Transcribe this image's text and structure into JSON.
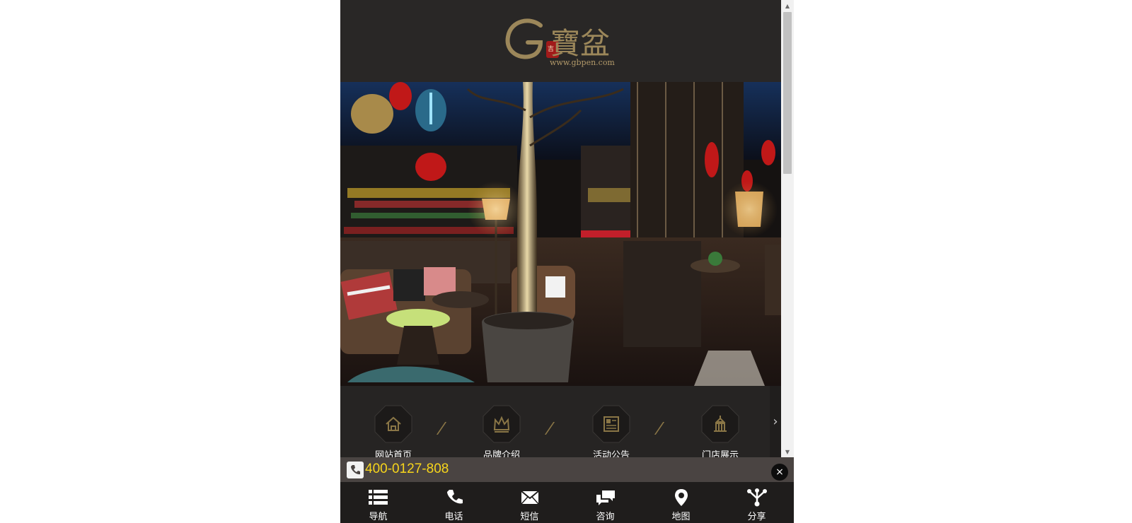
{
  "logo": {
    "brand_glyph": "G",
    "brand_text": "寶盆",
    "url": "www.gbpen.com"
  },
  "nav": {
    "items": [
      {
        "label": "网站首页",
        "icon": "home-icon"
      },
      {
        "label": "品牌介绍",
        "icon": "crown-icon"
      },
      {
        "label": "活动公告",
        "icon": "newspaper-icon"
      },
      {
        "label": "门店展示",
        "icon": "building-icon"
      }
    ],
    "separator": "/",
    "next": "›"
  },
  "phone_bar": {
    "number": "400-0127-808",
    "close": "×"
  },
  "bottom_bar": {
    "items": [
      {
        "label": "导航",
        "icon": "list-icon"
      },
      {
        "label": "电话",
        "icon": "phone-icon"
      },
      {
        "label": "短信",
        "icon": "envelope-icon"
      },
      {
        "label": "咨询",
        "icon": "chat-icon"
      },
      {
        "label": "地图",
        "icon": "map-pin-icon"
      },
      {
        "label": "分享",
        "icon": "share-icon"
      }
    ]
  },
  "scrollbar": {
    "up": "▲",
    "down": "▼"
  },
  "colors": {
    "accent_gold": "#8a7646",
    "phone_yellow": "#f7d51b",
    "dark_bg": "#262423"
  }
}
